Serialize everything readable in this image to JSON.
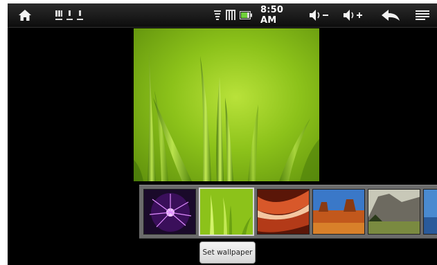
{
  "status_bar": {
    "time": "8:50 AM",
    "icons": [
      "home-icon",
      "usb-icon",
      "usb-debug-icon",
      "download-icon",
      "wifi-icon",
      "signal-icon",
      "battery-icon",
      "volume-down-icon",
      "volume-up-icon",
      "back-icon",
      "menu-icon"
    ]
  },
  "gallery": {
    "thumbnails": [
      "plasma-globe",
      "green-grass",
      "red-canyon",
      "desert-buttes",
      "yosemite-rocks",
      "lake-view"
    ],
    "selected_index": 1
  },
  "action": {
    "set_wallpaper_label": "Set wallpaper"
  },
  "colors": {
    "accent": "#8cc21a",
    "statusbar": "#1a1a1a",
    "gallery_bg": "#6b6b6b"
  }
}
